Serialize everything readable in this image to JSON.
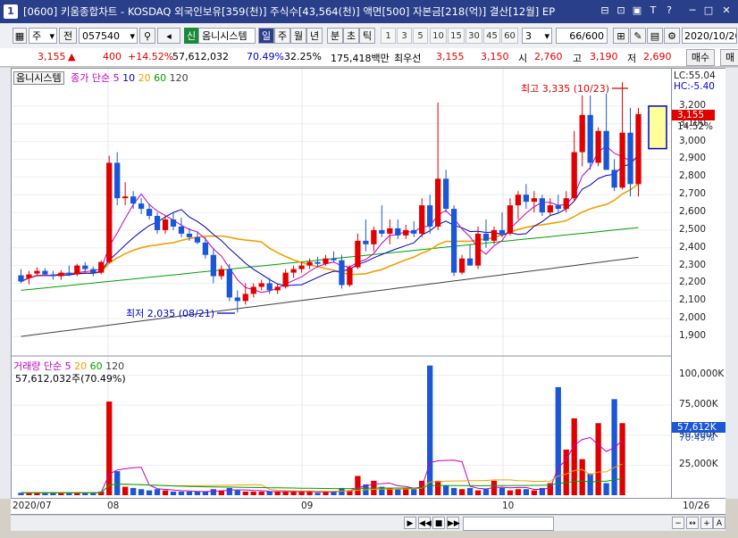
{
  "window": {
    "number": "1",
    "title": "[0600] 키움종합차트 - KOSDAQ 외국인보유[359(천)] 주식수[43,564(천)] 액면[500] 자본금[218(억)] 결산[12월] EP",
    "buttons": [
      "⊟",
      "⊡",
      "▣",
      "T",
      "?",
      "─",
      "□",
      "✕"
    ]
  },
  "toolbar": {
    "type_select": "주",
    "prev_label": "전",
    "stock_code": "057540",
    "search_icon": "⚲",
    "sound_icon": "◂",
    "new_badge": "신",
    "stock_name": "옴니시스템",
    "period_tabs": [
      "일",
      "주",
      "월",
      "년",
      "분",
      "초",
      "틱"
    ],
    "period_active": "일",
    "intervals": [
      "1",
      "3",
      "5",
      "10",
      "15",
      "30",
      "45",
      "60"
    ],
    "interval_select": "3",
    "count_value": "66",
    "count_total": "/600",
    "date_value": "2020/10/26"
  },
  "quote": {
    "price": "3,155",
    "change_arrow": "▲",
    "change": "400",
    "change_pct": "+14.52%",
    "volume": "57,612,032",
    "vol_ratio1": "70.49%",
    "vol_ratio2": "32.25%",
    "amount": "175,418백만",
    "best_offer_label": "최우선",
    "best_ask": "3,155",
    "best_bid": "3,150",
    "open_label": "시",
    "open": "2,760",
    "high_label": "고",
    "high": "3,190",
    "low_label": "저",
    "low": "2,690",
    "buy_button": "매수",
    "sell_button": "매"
  },
  "price_legend": {
    "stock": "옴니시스템",
    "ma_label": "종가 단순",
    "ma_periods": [
      "5",
      "10",
      "20",
      "60",
      "120"
    ]
  },
  "volume_legend": {
    "label": "거래량 단순",
    "ma_periods": [
      "5",
      "20",
      "60",
      "120"
    ],
    "current": "57,612,032주(70.49%)"
  },
  "annotations": {
    "high": "최고 3,335 (10/23)",
    "low": "최저 2,035 (08/21)"
  },
  "right_axis": {
    "lc": "LC:55.04",
    "hc": "HC:-5.40",
    "price_ticks": [
      "3,200",
      "3,100",
      "3,000",
      "2,900",
      "2,800",
      "2,700",
      "2,600",
      "2,500",
      "2,400",
      "2,300",
      "2,200",
      "2,100",
      "2,000",
      "1,900"
    ],
    "current_price": "3,155",
    "current_pct": "14.52%",
    "volume_ticks": [
      "100,000K",
      "75,000K",
      "50,000K",
      "25,000K"
    ],
    "current_volume": "57,612K",
    "current_volume_pct": "70.49%"
  },
  "x_axis": {
    "labels": [
      "2020/07",
      "08",
      "09",
      "10"
    ],
    "right_label": "10/26"
  },
  "colors": {
    "up": "#e00000",
    "down": "#1a56d6",
    "ma5": "#c000c0",
    "ma10": "#0000c0",
    "ma20": "#f0a000",
    "ma60": "#00a000",
    "ma120": "#404040"
  },
  "chart_data": {
    "type": "candlestick",
    "price_range": [
      1850,
      3260
    ],
    "volume_range": [
      0,
      110000
    ],
    "candles": [
      {
        "o": 2245,
        "h": 2280,
        "l": 2200,
        "c": 2210
      },
      {
        "o": 2230,
        "h": 2270,
        "l": 2195,
        "c": 2250
      },
      {
        "o": 2255,
        "h": 2290,
        "l": 2240,
        "c": 2270
      },
      {
        "o": 2270,
        "h": 2285,
        "l": 2240,
        "c": 2250
      },
      {
        "o": 2250,
        "h": 2270,
        "l": 2220,
        "c": 2240
      },
      {
        "o": 2240,
        "h": 2275,
        "l": 2220,
        "c": 2260
      },
      {
        "o": 2260,
        "h": 2300,
        "l": 2240,
        "c": 2250
      },
      {
        "o": 2250,
        "h": 2310,
        "l": 2240,
        "c": 2300
      },
      {
        "o": 2300,
        "h": 2320,
        "l": 2260,
        "c": 2280
      },
      {
        "o": 2280,
        "h": 2295,
        "l": 2240,
        "c": 2260
      },
      {
        "o": 2260,
        "h": 2330,
        "l": 2250,
        "c": 2320
      },
      {
        "o": 2320,
        "h": 2920,
        "l": 2310,
        "c": 2880
      },
      {
        "o": 2880,
        "h": 2940,
        "l": 2640,
        "c": 2680
      },
      {
        "o": 2680,
        "h": 2770,
        "l": 2640,
        "c": 2690
      },
      {
        "o": 2690,
        "h": 2720,
        "l": 2620,
        "c": 2650
      },
      {
        "o": 2650,
        "h": 2680,
        "l": 2590,
        "c": 2620
      },
      {
        "o": 2620,
        "h": 2650,
        "l": 2560,
        "c": 2580
      },
      {
        "o": 2580,
        "h": 2600,
        "l": 2480,
        "c": 2500
      },
      {
        "o": 2500,
        "h": 2580,
        "l": 2480,
        "c": 2560
      },
      {
        "o": 2560,
        "h": 2600,
        "l": 2500,
        "c": 2520
      },
      {
        "o": 2520,
        "h": 2570,
        "l": 2460,
        "c": 2480
      },
      {
        "o": 2480,
        "h": 2510,
        "l": 2440,
        "c": 2460
      },
      {
        "o": 2460,
        "h": 2490,
        "l": 2420,
        "c": 2430
      },
      {
        "o": 2430,
        "h": 2460,
        "l": 2340,
        "c": 2360
      },
      {
        "o": 2360,
        "h": 2400,
        "l": 2200,
        "c": 2240
      },
      {
        "o": 2240,
        "h": 2300,
        "l": 2220,
        "c": 2280
      },
      {
        "o": 2280,
        "h": 2310,
        "l": 2100,
        "c": 2120
      },
      {
        "o": 2120,
        "h": 2160,
        "l": 2035,
        "c": 2100
      },
      {
        "o": 2100,
        "h": 2200,
        "l": 2080,
        "c": 2140
      },
      {
        "o": 2140,
        "h": 2200,
        "l": 2120,
        "c": 2180
      },
      {
        "o": 2180,
        "h": 2220,
        "l": 2160,
        "c": 2200
      },
      {
        "o": 2200,
        "h": 2230,
        "l": 2140,
        "c": 2160
      },
      {
        "o": 2160,
        "h": 2200,
        "l": 2140,
        "c": 2180
      },
      {
        "o": 2180,
        "h": 2280,
        "l": 2170,
        "c": 2260
      },
      {
        "o": 2260,
        "h": 2300,
        "l": 2230,
        "c": 2280
      },
      {
        "o": 2280,
        "h": 2320,
        "l": 2260,
        "c": 2300
      },
      {
        "o": 2300,
        "h": 2340,
        "l": 2280,
        "c": 2320
      },
      {
        "o": 2320,
        "h": 2350,
        "l": 2290,
        "c": 2310
      },
      {
        "o": 2310,
        "h": 2360,
        "l": 2300,
        "c": 2340
      },
      {
        "o": 2340,
        "h": 2380,
        "l": 2320,
        "c": 2330
      },
      {
        "o": 2330,
        "h": 2360,
        "l": 2170,
        "c": 2190
      },
      {
        "o": 2190,
        "h": 2300,
        "l": 2180,
        "c": 2290
      },
      {
        "o": 2290,
        "h": 2480,
        "l": 2280,
        "c": 2440
      },
      {
        "o": 2440,
        "h": 2560,
        "l": 2380,
        "c": 2420
      },
      {
        "o": 2420,
        "h": 2520,
        "l": 2380,
        "c": 2500
      },
      {
        "o": 2500,
        "h": 2640,
        "l": 2460,
        "c": 2480
      },
      {
        "o": 2480,
        "h": 2560,
        "l": 2420,
        "c": 2510
      },
      {
        "o": 2510,
        "h": 2560,
        "l": 2450,
        "c": 2470
      },
      {
        "o": 2470,
        "h": 2530,
        "l": 2450,
        "c": 2500
      },
      {
        "o": 2500,
        "h": 2550,
        "l": 2460,
        "c": 2480
      },
      {
        "o": 2480,
        "h": 2680,
        "l": 2460,
        "c": 2640
      },
      {
        "o": 2640,
        "h": 2700,
        "l": 2480,
        "c": 2520
      },
      {
        "o": 2520,
        "h": 3220,
        "l": 2500,
        "c": 2790
      },
      {
        "o": 2790,
        "h": 2840,
        "l": 2600,
        "c": 2620
      },
      {
        "o": 2620,
        "h": 2640,
        "l": 2240,
        "c": 2260
      },
      {
        "o": 2260,
        "h": 2360,
        "l": 2250,
        "c": 2340
      },
      {
        "o": 2340,
        "h": 2420,
        "l": 2300,
        "c": 2300
      },
      {
        "o": 2300,
        "h": 2520,
        "l": 2280,
        "c": 2480
      },
      {
        "o": 2480,
        "h": 2560,
        "l": 2400,
        "c": 2440
      },
      {
        "o": 2440,
        "h": 2520,
        "l": 2420,
        "c": 2500
      },
      {
        "o": 2500,
        "h": 2600,
        "l": 2460,
        "c": 2480
      },
      {
        "o": 2480,
        "h": 2680,
        "l": 2470,
        "c": 2640
      },
      {
        "o": 2640,
        "h": 2720,
        "l": 2560,
        "c": 2700
      },
      {
        "o": 2700,
        "h": 2760,
        "l": 2620,
        "c": 2660
      },
      {
        "o": 2660,
        "h": 2720,
        "l": 2600,
        "c": 2680
      },
      {
        "o": 2680,
        "h": 2700,
        "l": 2580,
        "c": 2600
      },
      {
        "o": 2600,
        "h": 2680,
        "l": 2580,
        "c": 2640
      },
      {
        "o": 2640,
        "h": 2700,
        "l": 2600,
        "c": 2620
      },
      {
        "o": 2620,
        "h": 2720,
        "l": 2600,
        "c": 2680
      },
      {
        "o": 2680,
        "h": 3060,
        "l": 2660,
        "c": 2940
      },
      {
        "o": 2940,
        "h": 3260,
        "l": 2860,
        "c": 3150
      },
      {
        "o": 3150,
        "h": 3260,
        "l": 2840,
        "c": 2880
      },
      {
        "o": 2880,
        "h": 3080,
        "l": 2860,
        "c": 3060
      },
      {
        "o": 3060,
        "h": 3270,
        "l": 2880,
        "c": 2840
      },
      {
        "o": 2840,
        "h": 2900,
        "l": 2720,
        "c": 2740
      },
      {
        "o": 2740,
        "h": 3335,
        "l": 2730,
        "c": 3050
      },
      {
        "o": 3050,
        "h": 3190,
        "l": 2690,
        "c": 2760
      },
      {
        "o": 2760,
        "h": 3190,
        "l": 2690,
        "c": 3155
      }
    ],
    "volumes": [
      2,
      2,
      2,
      2,
      2,
      2,
      2,
      2,
      2,
      2,
      3,
      78,
      20,
      7,
      6,
      5,
      4,
      5,
      4,
      3,
      3,
      3,
      3,
      3,
      5,
      4,
      6,
      4,
      3,
      3,
      3,
      3,
      3,
      3,
      3,
      3,
      3,
      2,
      3,
      3,
      6,
      4,
      16,
      9,
      12,
      7,
      6,
      5,
      6,
      5,
      12,
      108,
      12,
      8,
      6,
      5,
      6,
      4,
      5,
      12,
      6,
      4,
      5,
      5,
      4,
      6,
      10,
      90,
      38,
      64,
      30,
      18,
      60,
      10,
      80,
      60
    ]
  }
}
